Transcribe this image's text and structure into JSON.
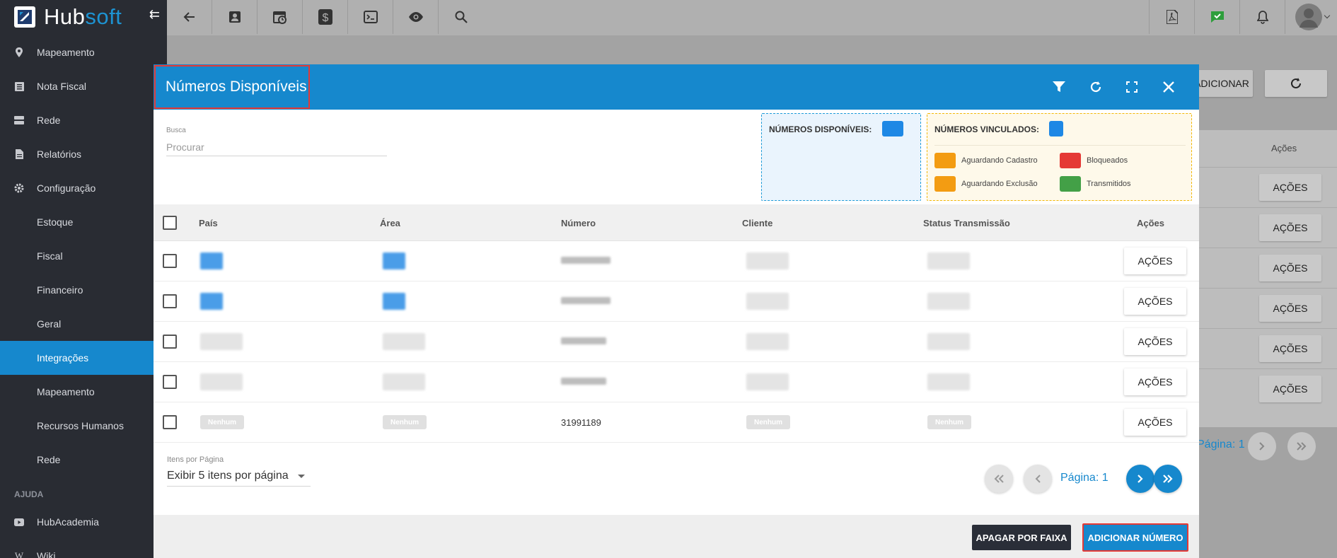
{
  "app": {
    "brand_main": "Hub",
    "brand_accent": "soft",
    "collapse_glyph": "⇇"
  },
  "colors": {
    "accent": "#1688cd",
    "sidebar": "#292c33",
    "highlight": "#e53935",
    "dark_button": "#2a2e38"
  },
  "sidebar": {
    "items": [
      {
        "label": "Mapeamento",
        "icon": "map-pin-icon"
      },
      {
        "label": "Nota Fiscal",
        "icon": "list-icon"
      },
      {
        "label": "Rede",
        "icon": "server-icon"
      },
      {
        "label": "Relatórios",
        "icon": "document-icon"
      },
      {
        "label": "Configuração",
        "icon": "gear-icon"
      }
    ],
    "subitems": [
      "Estoque",
      "Fiscal",
      "Financeiro",
      "Geral",
      "Integrações",
      "Mapeamento",
      "Recursos Humanos",
      "Rede"
    ],
    "active_subitem": "Integrações",
    "section_label": "AJUDA",
    "help_items": [
      {
        "label": "HubAcademia",
        "icon": "play-icon"
      },
      {
        "label": "Wiki",
        "icon": "wiki-icon"
      }
    ]
  },
  "topbar": {
    "icons": [
      "back-arrow-icon",
      "contact-card-icon",
      "calendar-clock-icon",
      "dollar-icon",
      "terminal-icon",
      "eye-icon",
      "search-icon"
    ],
    "right_icons": [
      "pdf-icon",
      "check-chat-icon",
      "bell-icon",
      "avatar"
    ]
  },
  "background": {
    "add_label": "ADICIONAR",
    "col_header": "Ações",
    "row_action": "AÇÕES",
    "page_label": "Página: 1"
  },
  "modal": {
    "title": "Números Disponíveis",
    "header_icons": [
      "filter-icon",
      "refresh-icon",
      "fullscreen-icon",
      "close-icon"
    ],
    "search": {
      "label": "Busca",
      "placeholder": "Procurar"
    },
    "legend": {
      "available_title": "NÚMEROS DISPONÍVEIS:",
      "linked_title": "NÚMEROS VINCULADOS:",
      "items": [
        {
          "label": "Aguardando Cadastro",
          "color": "#f39c12"
        },
        {
          "label": "Bloqueados",
          "color": "#e53935"
        },
        {
          "label": "Aguardando Exclusão",
          "color": "#f39c12"
        },
        {
          "label": "Transmitidos",
          "color": "#43a047"
        }
      ]
    },
    "table": {
      "columns": [
        "País",
        "Área",
        "Número",
        "Cliente",
        "Status Transmissão",
        "Ações"
      ],
      "row_action": "AÇÕES",
      "last_row": {
        "pais": "Nenhum",
        "area": "Nenhum",
        "numero": "31991189",
        "cliente": "Nenhum",
        "status": "Nenhum"
      }
    },
    "pagination": {
      "per_page_label": "Itens por Página",
      "per_page_value": "Exibir 5 itens por página",
      "page_label": "Página: 1"
    },
    "footer": {
      "delete_range": "APAGAR POR FAIXA",
      "add_number": "ADICIONAR NÚMERO"
    }
  }
}
